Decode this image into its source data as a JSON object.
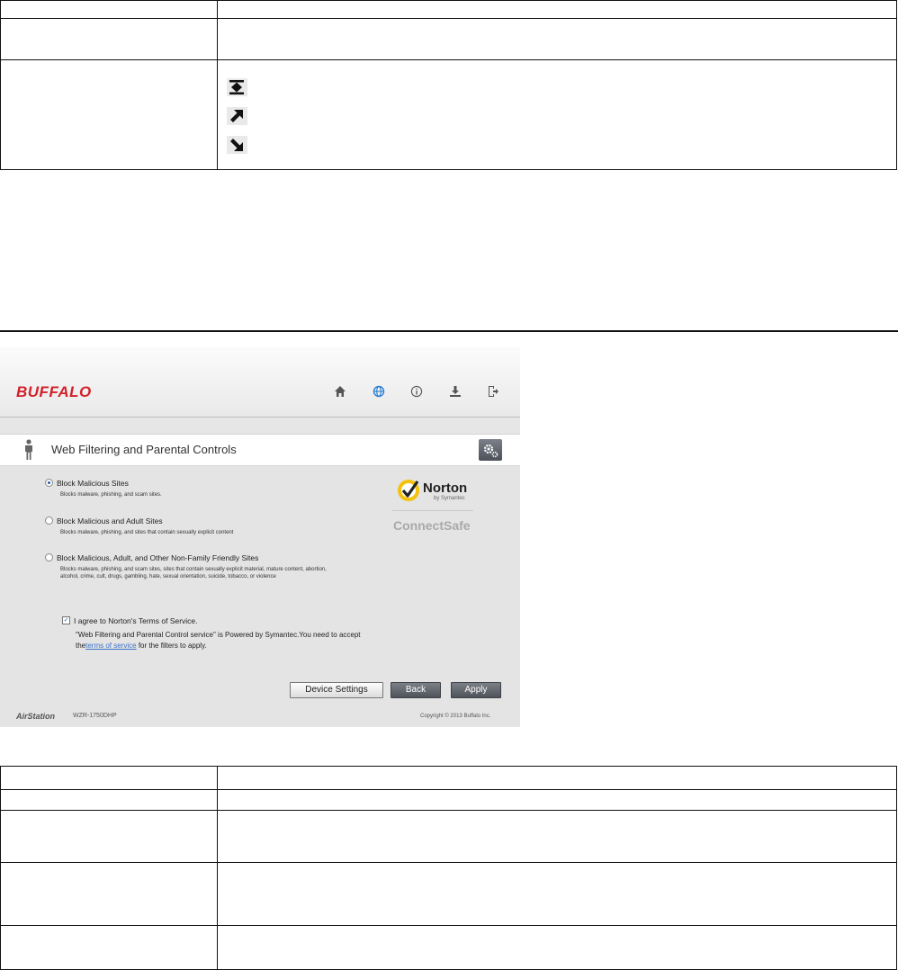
{
  "top_table": {
    "rows": [
      {
        "c1": "",
        "c2": ""
      },
      {
        "c1": "",
        "c2": ""
      },
      {
        "c1": "",
        "c2": ""
      }
    ],
    "icons": [
      "sort-both-icon",
      "arrow-up-right-icon",
      "arrow-down-right-icon"
    ]
  },
  "router": {
    "brand": "BUFFALO",
    "header_icons": [
      "home-icon",
      "globe-icon",
      "info-icon",
      "download-icon",
      "logout-icon"
    ],
    "accent_color": "#2a7fd4",
    "page_title": "Web Filtering and Parental Controls",
    "options": [
      {
        "label": "Block Malicious Sites",
        "desc": "Blocks malware, phishing, and scam sites.",
        "selected": true
      },
      {
        "label": "Block Malicious and Adult Sites",
        "desc": "Blocks malware, phishing, and sites that contain sexually explicit content",
        "selected": false
      },
      {
        "label": "Block Malicious, Adult, and Other Non-Family Friendly Sites",
        "desc": "Blocks malware, phishing, and scam sites, sites that contain sexually explicit material, mature content, abortion, alcohol, crime, cult, drugs, gambling, hate, sexual orientation, suicide, tobacco, or violence",
        "selected": false
      }
    ],
    "norton": {
      "word": "Norton",
      "sub": "by Symantec",
      "product": "ConnectSafe"
    },
    "agree_label": "I agree to Norton's Terms of Service.",
    "agree_checked": true,
    "note_prefix": "\"Web Filtering and Parental Control service\" is Powered by Symantec.You need to accept the",
    "note_link": "terms of service",
    "note_suffix": " for the filters to apply.",
    "buttons": {
      "device_settings": "Device Settings",
      "back": "Back",
      "apply": "Apply"
    },
    "footer": {
      "brand": "AirStation",
      "model": "WZR-1750DHP",
      "copyright": "Copyright © 2013 Buffalo Inc."
    }
  },
  "bottom_table": {
    "rows": [
      {
        "c1": "",
        "c2": ""
      },
      {
        "c1": "",
        "c2": ""
      },
      {
        "c1": "",
        "c2": ""
      },
      {
        "c1": "",
        "c2": ""
      },
      {
        "c1": "",
        "c2": ""
      }
    ]
  }
}
